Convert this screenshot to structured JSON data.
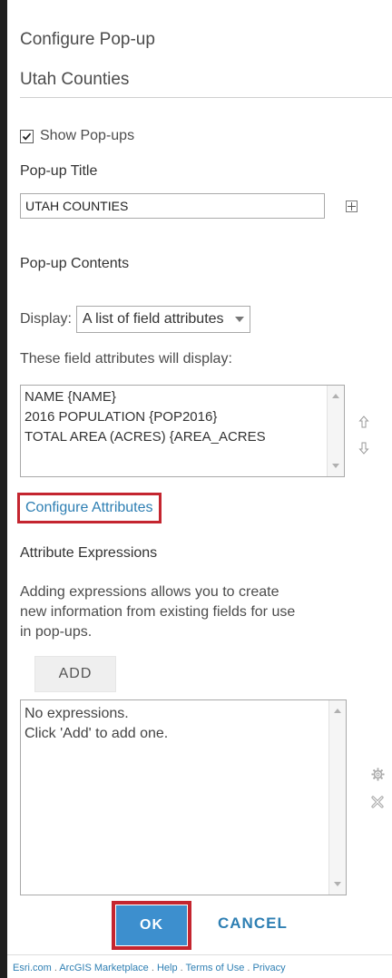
{
  "header": {
    "title": "Configure Pop-up",
    "layer_name": "Utah Counties"
  },
  "show_popups": {
    "label": "Show Pop-ups",
    "checked": true
  },
  "popup_title": {
    "heading": "Pop-up Title",
    "value": "UTAH COUNTIES"
  },
  "popup_contents": {
    "heading": "Pop-up Contents",
    "display_label": "Display:",
    "display_value": "A list of field attributes",
    "fields_caption": "These field attributes will display:",
    "fields": [
      "NAME {NAME}",
      "2016 POPULATION {POP2016}",
      "TOTAL AREA (ACRES) {AREA_ACRES"
    ],
    "configure_link": "Configure Attributes"
  },
  "attribute_expressions": {
    "heading": "Attribute Expressions",
    "description_lines": [
      "Adding expressions allows you to create",
      "new information from existing fields for use",
      "in pop-ups."
    ],
    "add_label": "ADD",
    "empty_lines": [
      "No expressions.",
      "Click 'Add' to add one."
    ]
  },
  "actions": {
    "ok_label": "OK",
    "cancel_label": "CANCEL"
  },
  "footer": {
    "links": [
      "Esri.com",
      "ArcGIS Marketplace",
      "Help",
      "Terms of Use",
      "Privacy"
    ],
    "separator": " . "
  },
  "colors": {
    "accent": "#3d8fce",
    "link": "#2e7fb3",
    "highlight": "#c4252f"
  },
  "icons": [
    "checkbox-icon",
    "plus-icon",
    "move-up-icon",
    "move-down-icon",
    "gear-icon",
    "delete-icon"
  ]
}
